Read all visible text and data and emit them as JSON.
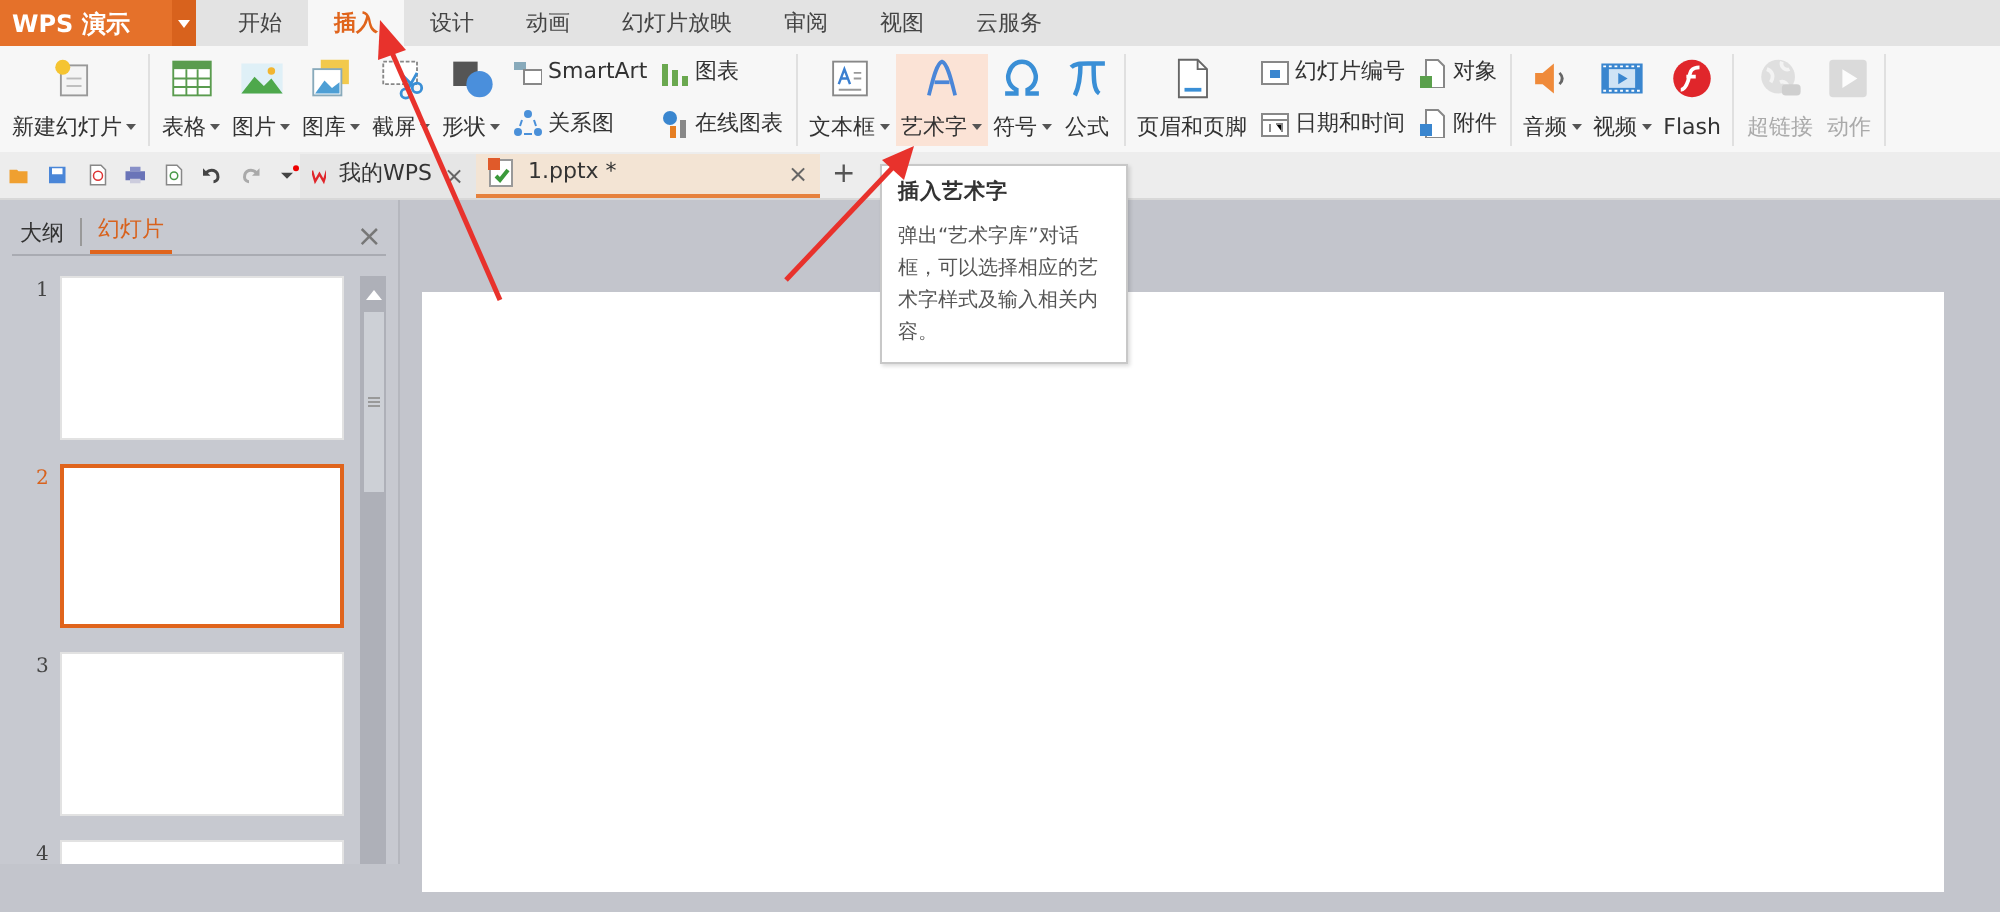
{
  "app": {
    "title": "WPS 演示"
  },
  "menu_tabs": [
    {
      "label": "开始",
      "selected": false
    },
    {
      "label": "插入",
      "selected": true
    },
    {
      "label": "设计",
      "selected": false
    },
    {
      "label": "动画",
      "selected": false
    },
    {
      "label": "幻灯片放映",
      "selected": false
    },
    {
      "label": "审阅",
      "selected": false
    },
    {
      "label": "视图",
      "selected": false
    },
    {
      "label": "云服务",
      "selected": false
    }
  ],
  "ribbon": {
    "groups": [
      {
        "items": [
          {
            "kind": "large",
            "label": "新建幻灯片",
            "dropdown": true,
            "disabled": false,
            "hovered": false
          }
        ]
      },
      {
        "items": [
          {
            "kind": "large",
            "label": "表格",
            "dropdown": true,
            "disabled": false,
            "hovered": false
          },
          {
            "kind": "large",
            "label": "图片",
            "dropdown": true,
            "disabled": false,
            "hovered": false
          },
          {
            "kind": "large",
            "label": "图库",
            "dropdown": true,
            "disabled": false,
            "hovered": false
          },
          {
            "kind": "large",
            "label": "截屏",
            "dropdown": true,
            "disabled": false,
            "hovered": false
          },
          {
            "kind": "large",
            "label": "形状",
            "dropdown": true,
            "disabled": false,
            "hovered": false
          },
          {
            "kind": "stack",
            "entries": [
              {
                "label": "SmartArt"
              },
              {
                "label": "关系图"
              }
            ]
          },
          {
            "kind": "stack",
            "entries": [
              {
                "label": "图表"
              },
              {
                "label": "在线图表"
              }
            ]
          }
        ]
      },
      {
        "items": [
          {
            "kind": "large",
            "label": "文本框",
            "dropdown": true,
            "disabled": false,
            "hovered": false
          },
          {
            "kind": "large",
            "label": "艺术字",
            "dropdown": true,
            "disabled": false,
            "hovered": true
          },
          {
            "kind": "large",
            "label": "符号",
            "dropdown": true,
            "disabled": false,
            "hovered": false
          },
          {
            "kind": "large",
            "label": "公式",
            "dropdown": false,
            "disabled": false,
            "hovered": false
          }
        ]
      },
      {
        "items": [
          {
            "kind": "large",
            "label": "页眉和页脚",
            "dropdown": false,
            "disabled": false,
            "hovered": false
          },
          {
            "kind": "stack",
            "entries": [
              {
                "label": "幻灯片编号"
              },
              {
                "label": "日期和时间"
              }
            ]
          },
          {
            "kind": "stack",
            "entries": [
              {
                "label": "对象"
              },
              {
                "label": "附件"
              }
            ]
          }
        ]
      },
      {
        "items": [
          {
            "kind": "large",
            "label": "音频",
            "dropdown": true,
            "disabled": false,
            "hovered": false
          },
          {
            "kind": "large",
            "label": "视频",
            "dropdown": true,
            "disabled": false,
            "hovered": false
          },
          {
            "kind": "large",
            "label": "Flash",
            "dropdown": false,
            "disabled": false,
            "hovered": false
          }
        ]
      },
      {
        "items": [
          {
            "kind": "large",
            "label": "超链接",
            "dropdown": false,
            "disabled": true,
            "hovered": false
          },
          {
            "kind": "large",
            "label": "动作",
            "dropdown": false,
            "disabled": true,
            "hovered": false
          }
        ]
      }
    ]
  },
  "doc_tabs": [
    {
      "label": "我的WPS",
      "close": "×",
      "selected": false
    },
    {
      "label": "1.pptx *",
      "close": "×",
      "selected": true
    }
  ],
  "new_tab": "+",
  "side_panel": {
    "tabs": [
      {
        "label": "大纲",
        "selected": false
      },
      {
        "label": "幻灯片",
        "selected": true
      }
    ],
    "close": "×",
    "slides": [
      {
        "number": "1",
        "selected": false
      },
      {
        "number": "2",
        "selected": true
      },
      {
        "number": "3",
        "selected": false
      },
      {
        "number": "4",
        "selected": false
      }
    ]
  },
  "tooltip": {
    "title": "插入艺术字",
    "body": "弹出“艺术字库”对话框，可以选择相应的艺术字样式及输入相关内容。"
  }
}
